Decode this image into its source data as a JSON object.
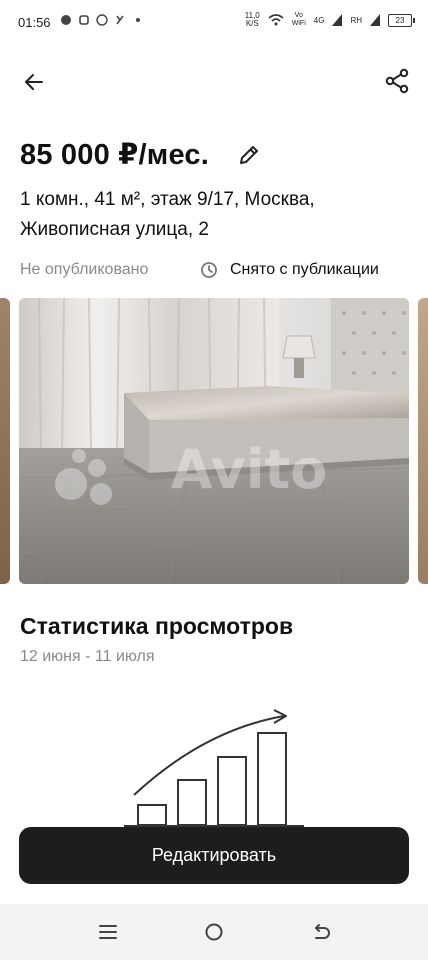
{
  "status_bar": {
    "time": "01:56",
    "speed_value": "11,0",
    "speed_unit": "K/S",
    "vo_wifi_top": "Vo",
    "vo_wifi_bottom": "WiFi",
    "signal_4g": "4G",
    "signal_rh": "RH",
    "battery": "23"
  },
  "listing": {
    "price": "85 000 ₽/мес.",
    "description": "1 комн., 41 м², этаж 9/17, Москва, Живописная улица, 2",
    "status_left": "Не опубликовано",
    "status_right": "Снято с публикации",
    "watermark": "Avito"
  },
  "stats": {
    "title": "Статистика просмотров",
    "date_range": "12 июня - 11 июля"
  },
  "actions": {
    "edit_label": "Редактировать"
  },
  "icons": {
    "back": "arrow-left-icon",
    "share": "share-icon",
    "edit": "pencil-icon",
    "clock": "clock-icon",
    "nav_menu": "menu-icon",
    "nav_home": "circle-home-icon",
    "nav_back": "return-icon"
  }
}
